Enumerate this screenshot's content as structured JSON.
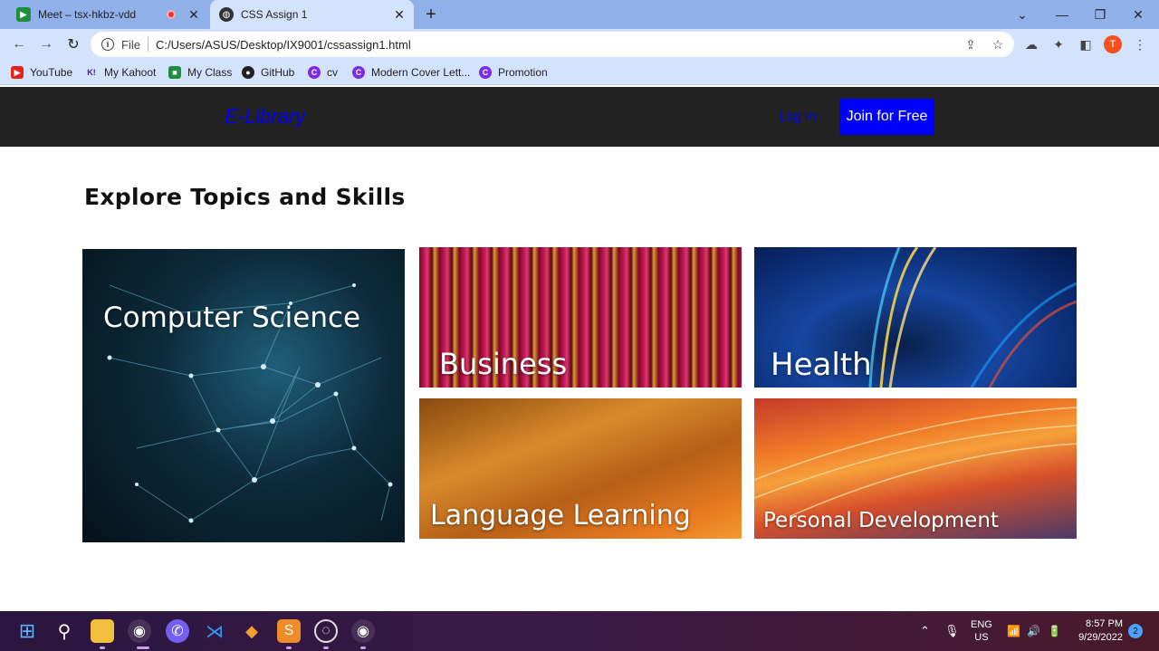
{
  "browser": {
    "tabs": [
      {
        "title": "Meet – tsx-hkbz-vdd",
        "active": false
      },
      {
        "title": "CSS Assign 1",
        "active": true
      }
    ],
    "address": {
      "scheme": "File",
      "url": "C:/Users/ASUS/Desktop/IX9001/cssassign1.html"
    },
    "profile_initial": "T",
    "bookmarks": [
      {
        "label": "YouTube",
        "icon": "youtube-icon",
        "color": "#e62117"
      },
      {
        "label": "My Kahoot",
        "icon": "kahoot-icon",
        "color": "#46178f"
      },
      {
        "label": "My Class",
        "icon": "google-classroom-icon",
        "color": "#1e8e3e"
      },
      {
        "label": "GitHub",
        "icon": "github-icon",
        "color": "#222222"
      },
      {
        "label": "cv",
        "icon": "canva-icon",
        "color": "#7d2ae8"
      },
      {
        "label": "Modern Cover Lett...",
        "icon": "canva-icon",
        "color": "#7d2ae8"
      },
      {
        "label": "Promotion",
        "icon": "canva-icon",
        "color": "#7d2ae8"
      }
    ]
  },
  "site": {
    "logo": "E-Library",
    "login": "Log In",
    "join": "Join for Free",
    "section_title": "Explore Topics and Skills",
    "cards": [
      {
        "label": "Computer Science"
      },
      {
        "label": "Business"
      },
      {
        "label": "Health"
      },
      {
        "label": "Language Learning"
      },
      {
        "label": "Personal Development"
      }
    ],
    "colors": {
      "header_bg": "#222222",
      "accent": "#0000ff"
    }
  },
  "taskbar": {
    "lang_top": "ENG",
    "lang_bottom": "US",
    "time": "8:57 PM",
    "date": "9/29/2022",
    "notifications": "2"
  }
}
